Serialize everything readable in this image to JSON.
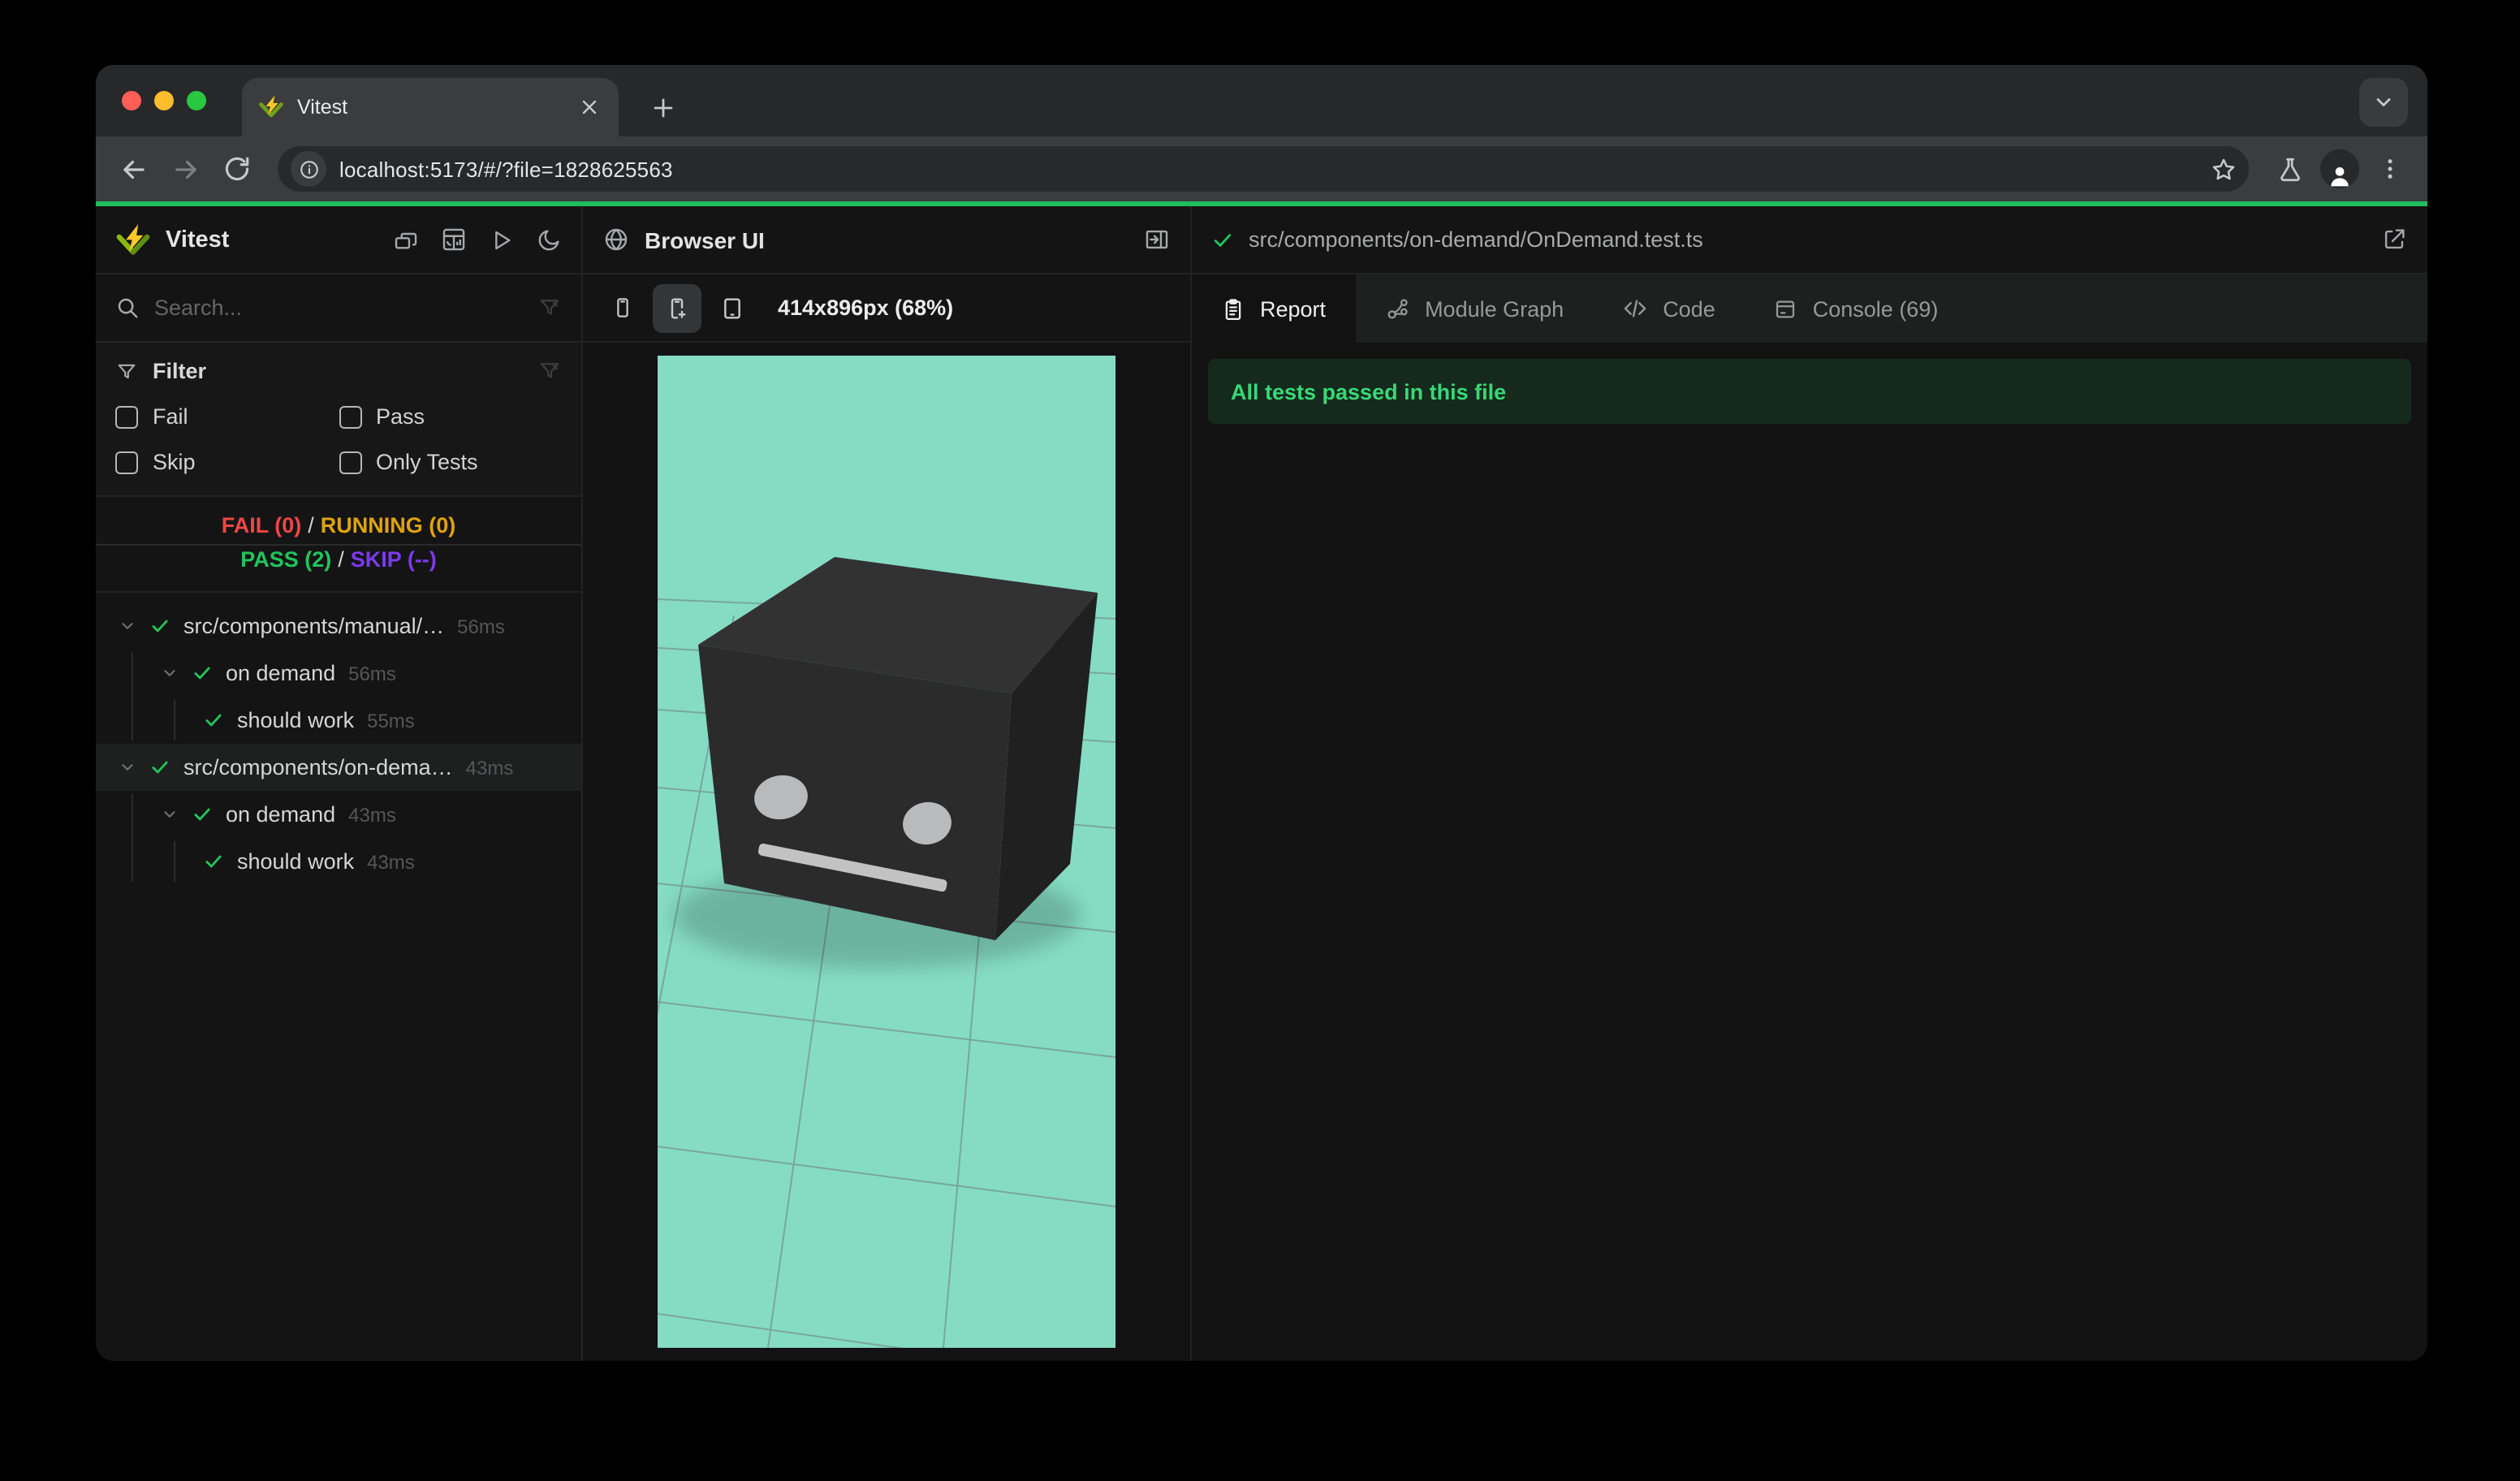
{
  "browser": {
    "tab_title": "Vitest",
    "url": "localhost:5173/#/?file=1828625563",
    "new_tab_label": "+",
    "colors": {
      "traffic_red": "#ff5f57",
      "traffic_yellow": "#febc2e",
      "traffic_green": "#28c840"
    }
  },
  "progress_bar_color": "#1fbe5f",
  "sidebar": {
    "app_name": "Vitest",
    "search_placeholder": "Search...",
    "filter": {
      "title": "Filter",
      "options": [
        {
          "label": "Fail",
          "checked": false
        },
        {
          "label": "Pass",
          "checked": false
        },
        {
          "label": "Skip",
          "checked": false
        },
        {
          "label": "Only Tests",
          "checked": false
        }
      ]
    },
    "summary": {
      "fail": "FAIL (0)",
      "running": "RUNNING (0)",
      "pass": "PASS (2)",
      "skip": "SKIP (--)",
      "separator": "/",
      "colors": {
        "fail": "#f04545",
        "running": "#dfa30f",
        "pass": "#21c45d",
        "skip": "#7c3aed"
      }
    },
    "tree": [
      {
        "label": "src/components/manual/…",
        "duration": "56ms",
        "level": 0,
        "status": "pass",
        "selected": false
      },
      {
        "label": "on demand",
        "duration": "56ms",
        "level": 1,
        "status": "pass"
      },
      {
        "label": "should work",
        "duration": "55ms",
        "level": 2,
        "status": "pass"
      },
      {
        "label": "src/components/on-dema…",
        "duration": "43ms",
        "level": 0,
        "status": "pass",
        "selected": true
      },
      {
        "label": "on demand",
        "duration": "43ms",
        "level": 1,
        "status": "pass"
      },
      {
        "label": "should work",
        "duration": "43ms",
        "level": 2,
        "status": "pass"
      }
    ]
  },
  "preview": {
    "title": "Browser UI",
    "device_size_label": "414x896px (68%)",
    "selected_device": "phone-plus",
    "viewport_bg": "#85dcc2",
    "scene": {
      "object": "dark cube robot head with two gray eyes and gray mouth on teal gridded floor"
    }
  },
  "detail": {
    "file_status": "pass",
    "file_path": "src/components/on-demand/OnDemand.test.ts",
    "tabs": [
      {
        "label": "Report",
        "active": true
      },
      {
        "label": "Module Graph",
        "active": false
      },
      {
        "label": "Code",
        "active": false
      },
      {
        "label": "Console (69)",
        "active": false
      }
    ],
    "banner_text": "All tests passed in this file",
    "banner_colors": {
      "bg": "#15291c",
      "text": "#38d877"
    }
  },
  "icons": {
    "sidebar_header": [
      "cascade-windows-icon",
      "dashboard-icon",
      "run-all-icon",
      "dark-mode-moon-icon"
    ],
    "search_row": [
      "search-icon",
      "clear-filter-icon"
    ],
    "preview_header": [
      "globe-icon",
      "dock-panel-right-icon"
    ],
    "device_toolbar": [
      "phone-icon",
      "phone-plus-icon",
      "tablet-icon"
    ],
    "detail_header": [
      "check-icon",
      "external-link-icon"
    ],
    "tabs": [
      "report-clipboard-icon",
      "module-graph-icon",
      "code-icon",
      "console-icon"
    ]
  }
}
